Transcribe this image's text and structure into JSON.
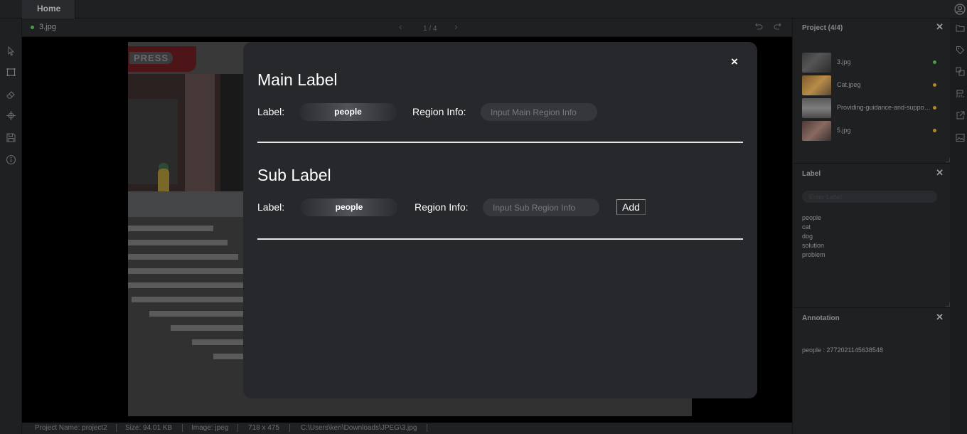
{
  "topbar": {
    "home_tab": "Home",
    "user_icon": "user-circle-icon"
  },
  "left_toolbar": {
    "tools": [
      "select-pointer-icon",
      "rectangle-icon",
      "eraser-icon",
      "crosshair-icon",
      "save-icon",
      "info-icon"
    ]
  },
  "filebar": {
    "file_name": "3.jpg",
    "file_status_color": "#4c9a49",
    "pager_prev": "‹",
    "pager": "1 / 4",
    "pager_next": "›",
    "undo_icon": "undo-icon",
    "redo_icon": "redo-icon"
  },
  "canvas": {
    "store_sign": "PRESS"
  },
  "modal": {
    "close_label": "×",
    "main": {
      "title": "Main Label",
      "label_caption": "Label:",
      "label_value": "people",
      "region_caption": "Region Info:",
      "region_placeholder": "Input Main Region Info"
    },
    "sub": {
      "title": "Sub Label",
      "label_caption": "Label:",
      "label_value": "people",
      "region_caption": "Region Info:",
      "region_placeholder": "Input Sub Region Info",
      "add_label": "Add"
    }
  },
  "project_panel": {
    "title": "Project (4/4)",
    "close": "✕",
    "items": [
      {
        "name": "3.jpg",
        "status_color": "#4c9a49"
      },
      {
        "name": "Cat.jpeg",
        "status_color": "#b08a2a"
      },
      {
        "name": "Providing-guidance-and-support.png",
        "status_color": "#b08a2a"
      },
      {
        "name": "5.jpg",
        "status_color": "#b08a2a"
      }
    ]
  },
  "label_panel": {
    "title": "Label",
    "close": "✕",
    "search_placeholder": "Enter Label",
    "items": [
      "people",
      "cat",
      "dog",
      "solution",
      "problem"
    ]
  },
  "annotation_panel": {
    "title": "Annotation",
    "close": "✕",
    "items": [
      "people : 2772021145638548"
    ]
  },
  "right_icons": [
    "folder-icon",
    "tag-icon",
    "shapes-icon",
    "flag-chart-icon",
    "export-icon",
    "image-icon"
  ],
  "statusbar": {
    "project_name": "Project Name: project2",
    "size": "Size: 94.01 KB",
    "image_type": "Image: jpeg",
    "dimensions": "718 x 475",
    "path": "C:\\Users\\ken\\Downloads\\JPEG\\3.jpg"
  }
}
